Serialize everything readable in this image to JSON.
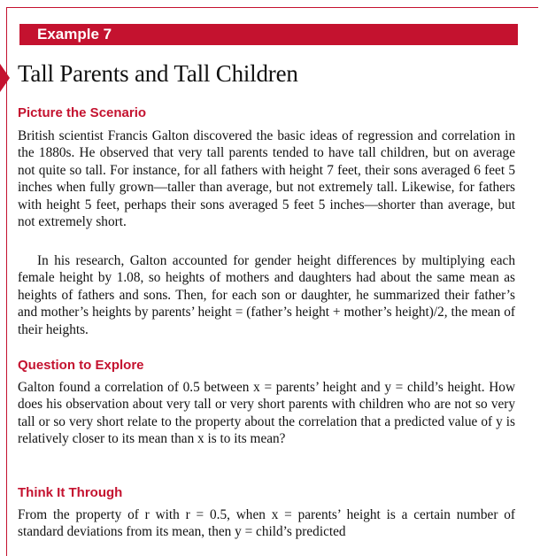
{
  "example_label": "Example 7",
  "title": "Tall Parents and Tall Children",
  "sections": {
    "scenario_heading": "Picture the Scenario",
    "scenario_p1": "British scientist Francis Galton discovered the basic ideas of regression and correlation in the 1880s. He observed that very tall parents tended to have tall children, but on average not quite so tall. For instance, for all fathers with height 7 feet, their sons averaged 6 feet 5 inches when fully grown—taller than average, but not extremely tall. Likewise, for fathers with height 5 feet, perhaps their sons averaged 5 feet 5 inches—shorter than average, but not extremely short.",
    "scenario_p2": "In his research, Galton accounted for gender height differences by multiplying each female height by 1.08, so heights of mothers and daughters had about the same mean as heights of fathers and sons. Then, for each son or daughter, he summarized their father’s and mother’s heights by parents’ height = (father’s height + mother’s height)/2, the mean of their heights.",
    "question_heading": "Question to Explore",
    "question_p": "Galton found a correlation of 0.5 between x = parents’ height and y = child’s height. How does his observation about very tall or very short parents with children who are not so very tall or so very short relate to the property about the correlation that a predicted value of y is relatively closer to its mean than x is to its mean?",
    "think_heading": "Think It Through",
    "think_p": "From the property of r with r = 0.5, when x = parents’ height is a certain number of standard deviations from its mean, then y = child’s predicted"
  }
}
